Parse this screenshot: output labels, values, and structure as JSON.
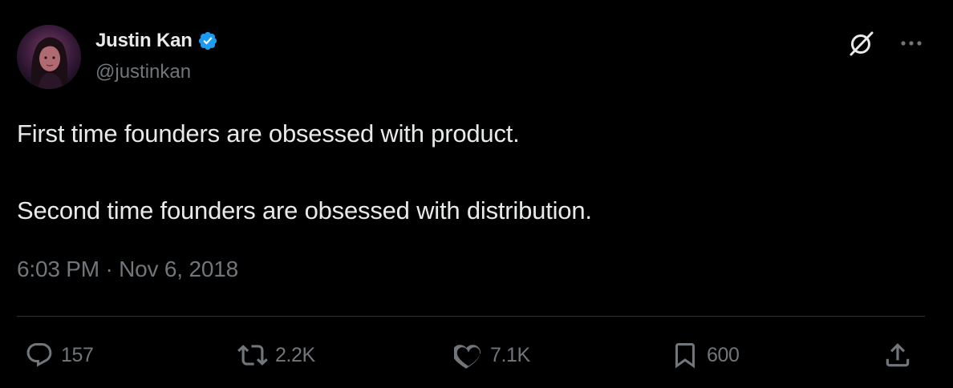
{
  "author": {
    "display_name": "Justin Kan",
    "handle": "@justinkan",
    "verified": true,
    "avatar": "avatar-photo"
  },
  "tweet": {
    "lines": [
      "First time founders are obsessed with product.",
      "Second time founders are obsessed with distribution."
    ],
    "timestamp": "6:03 PM · Nov 6, 2018"
  },
  "top_actions": {
    "grok_icon": "grok-icon",
    "more_icon": "more-icon"
  },
  "engagement": {
    "replies": "157",
    "reposts": "2.2K",
    "likes": "7.1K",
    "bookmarks": "600"
  },
  "icons": {
    "reply": "reply-icon",
    "repost": "repost-icon",
    "like": "heart-icon",
    "bookmark": "bookmark-icon",
    "share": "share-icon"
  },
  "colors": {
    "background": "#000000",
    "text_primary": "#e7e9ea",
    "text_secondary": "#71767b",
    "verified_blue": "#1d9bf0",
    "divider": "#2f3336"
  }
}
